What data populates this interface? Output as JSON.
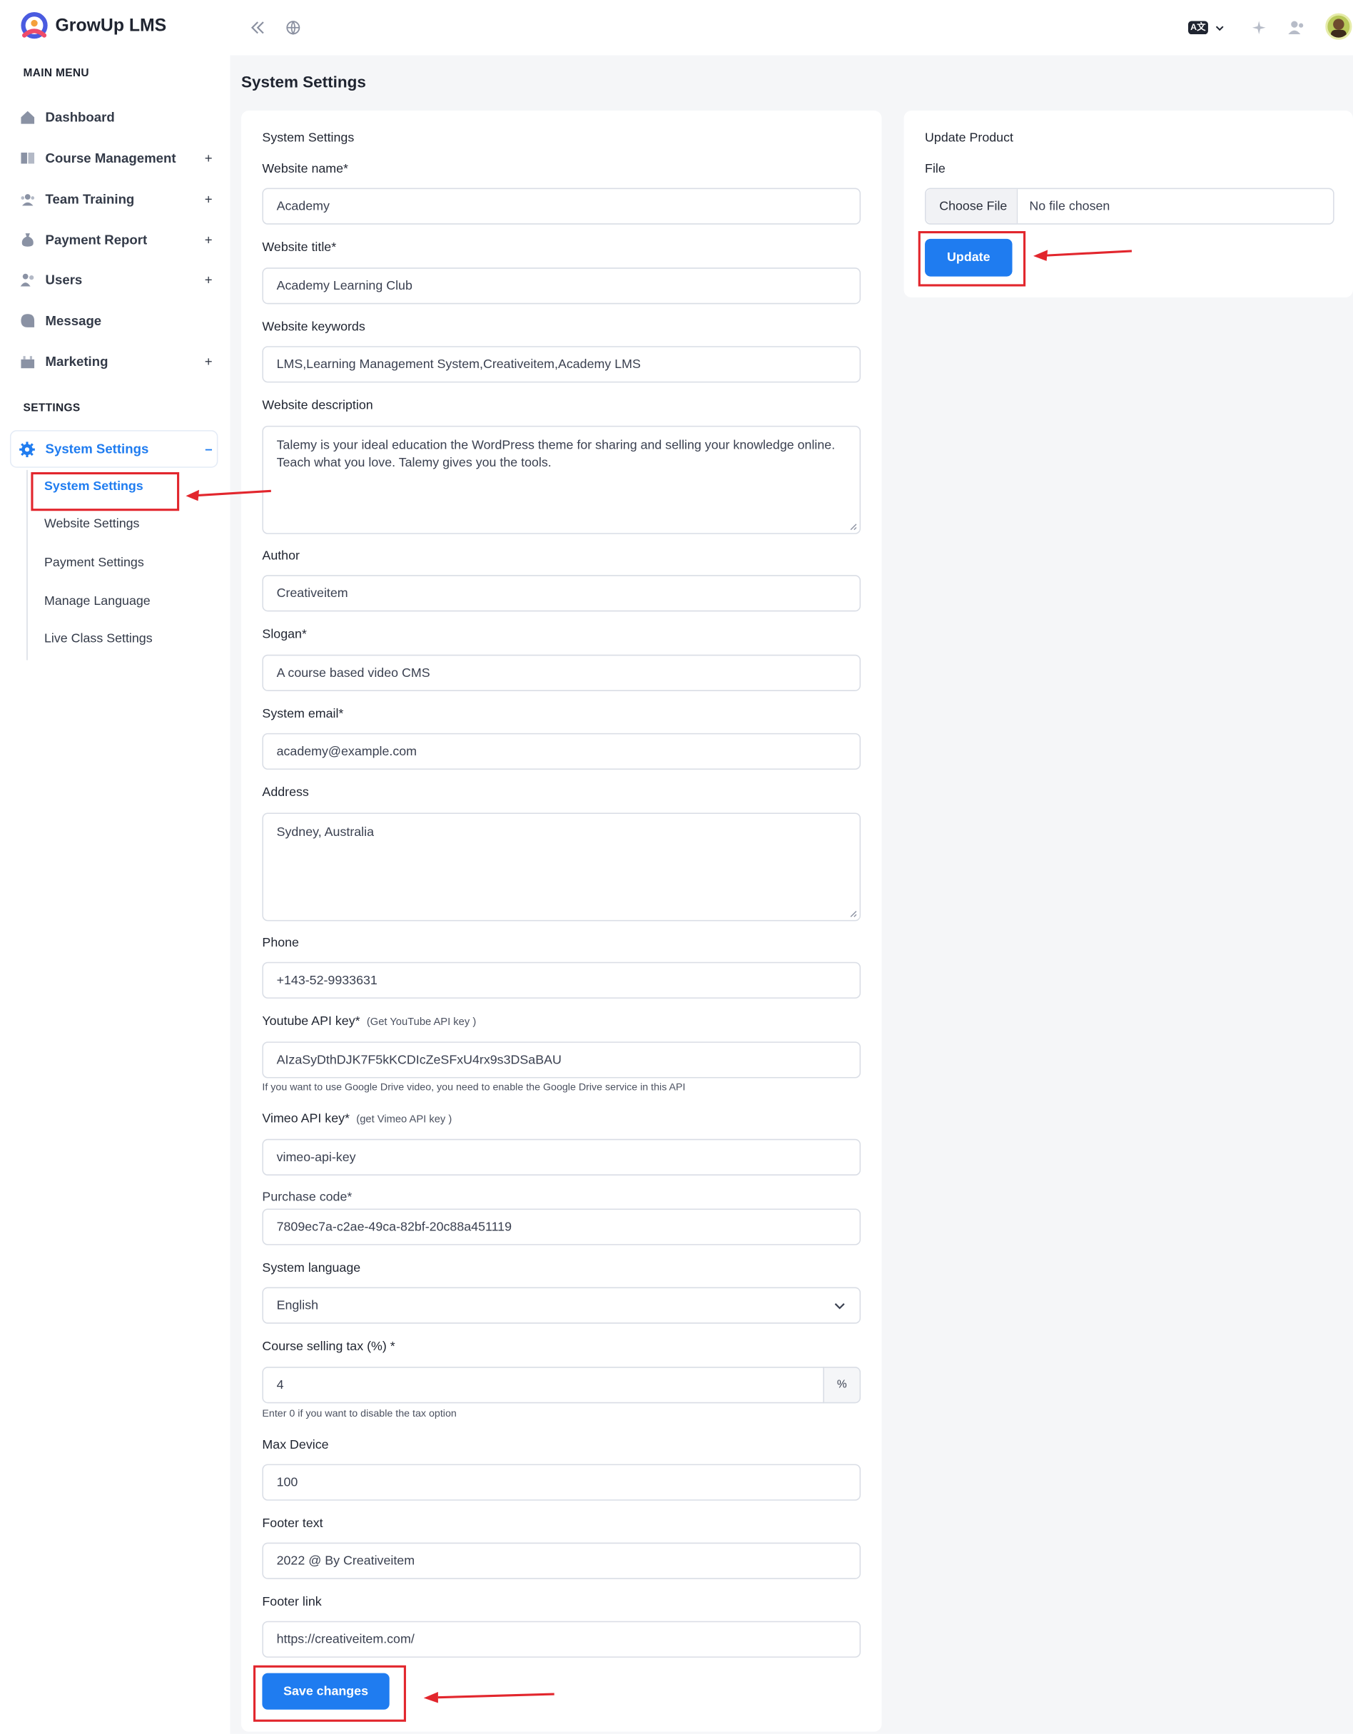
{
  "app": {
    "brand": "GrowUp LMS",
    "page_title": "System Settings"
  },
  "header": {
    "language_code": "A文"
  },
  "sidebar": {
    "main_menu_title": "MAIN MENU",
    "items": [
      {
        "label": "Dashboard",
        "icon": "home-icon",
        "expandable": false
      },
      {
        "label": "Course Management",
        "icon": "book-icon",
        "expandable": true
      },
      {
        "label": "Team Training",
        "icon": "team-icon",
        "expandable": true
      },
      {
        "label": "Payment Report",
        "icon": "money-bag-icon",
        "expandable": true
      },
      {
        "label": "Users",
        "icon": "users-icon",
        "expandable": true
      },
      {
        "label": "Message",
        "icon": "message-icon",
        "expandable": false
      },
      {
        "label": "Marketing",
        "icon": "marketing-icon",
        "expandable": true
      }
    ],
    "settings_title": "SETTINGS",
    "active_group": {
      "label": "System Settings",
      "icon": "gear-icon",
      "toggle": "–"
    },
    "sub_items": [
      "System Settings",
      "Website Settings",
      "Payment Settings",
      "Manage Language",
      "Live Class Settings"
    ],
    "expand_symbol": "+"
  },
  "form": {
    "heading": "System Settings",
    "website_name": {
      "label": "Website name*",
      "value": "Academy"
    },
    "website_title": {
      "label": "Website title*",
      "value": "Academy Learning Club"
    },
    "website_keywords": {
      "label": "Website keywords",
      "value": "LMS,Learning Management System,Creativeitem,Academy LMS"
    },
    "website_description": {
      "label": "Website description",
      "value": "Talemy is your ideal education the WordPress theme for sharing and selling your knowledge online. Teach what you love. Talemy gives you the tools."
    },
    "author": {
      "label": "Author",
      "value": "Creativeitem"
    },
    "slogan": {
      "label": "Slogan*",
      "value": "A course based video CMS"
    },
    "system_email": {
      "label": "System email*",
      "value": "academy@example.com"
    },
    "address": {
      "label": "Address",
      "value": "Sydney, Australia"
    },
    "phone": {
      "label": "Phone",
      "value": "+143-52-9933631"
    },
    "youtube_api_key": {
      "label": "Youtube API key*",
      "hint": "(Get YouTube API key )",
      "value": "AIzaSyDthDJK7F5kKCDIcZeSFxU4rx9s3DSaBAU",
      "help": "If you want to use Google Drive video, you need to enable the Google Drive service in this API"
    },
    "vimeo_api_key": {
      "label": "Vimeo API key*",
      "hint": "(get Vimeo API key )",
      "value": "vimeo-api-key"
    },
    "purchase_code": {
      "label": "Purchase code*",
      "value": "7809ec7a-c2ae-49ca-82bf-20c88a451119"
    },
    "system_language": {
      "label": "System language",
      "value": "English"
    },
    "course_selling_tax": {
      "label": "Course selling tax (%) *",
      "value": "4",
      "suffix": "%",
      "help": "Enter 0 if you want to disable the tax option"
    },
    "max_device": {
      "label": "Max Device",
      "value": "100"
    },
    "footer_text": {
      "label": "Footer text",
      "value": "2022 @ By Creativeitem"
    },
    "footer_link": {
      "label": "Footer link",
      "value": "https://creativeitem.com/"
    },
    "save_button": "Save changes"
  },
  "update_product": {
    "heading": "Update Product",
    "file_label": "File",
    "choose_button": "Choose File",
    "file_status": "No file chosen",
    "update_button": "Update"
  },
  "colors": {
    "accent": "#1f7cf0",
    "annotation": "#e2262d",
    "content_bg": "#f5f6f8"
  }
}
